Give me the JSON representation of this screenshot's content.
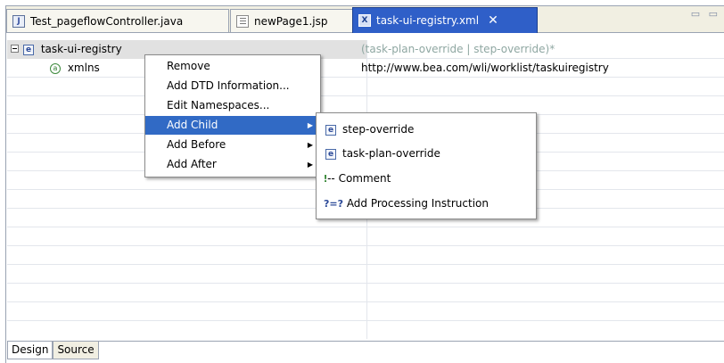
{
  "tabs": [
    {
      "label": "Test_pageflowController.java",
      "icon": "java-file-icon",
      "icon_glyph": "J"
    },
    {
      "label": "newPage1.jsp",
      "icon": "jsp-file-icon"
    },
    {
      "label": "task-ui-registry.xml",
      "icon": "xml-file-icon",
      "icon_glyph": "X",
      "close": "✕"
    }
  ],
  "window_controls": "▭ ▭",
  "tree": {
    "root": {
      "name": "task-ui-registry",
      "icon_glyph": "e",
      "value": "(task-plan-override | step-override)*"
    },
    "attr": {
      "name": "xmlns",
      "icon_glyph": "a",
      "value": "http://www.bea.com/wli/worklist/taskuiregistry"
    }
  },
  "context_menu": {
    "items": [
      "Remove",
      "Add DTD Information...",
      "Edit Namespaces...",
      "Add Child",
      "Add Before",
      "Add After"
    ],
    "highlighted": "Add Child"
  },
  "submenu": {
    "items": [
      {
        "label": "step-override",
        "icon": "element-icon",
        "glyph": "e"
      },
      {
        "label": "task-plan-override",
        "icon": "element-icon",
        "glyph": "e"
      },
      {
        "label": "Comment",
        "icon": "comment-icon",
        "glyph": "-- "
      },
      {
        "label": "Add Processing Instruction",
        "icon": "processing-instruction-icon",
        "glyph": "?=? "
      }
    ]
  },
  "bottom_tabs": [
    "Design",
    "Source"
  ],
  "colors": {
    "active_tab": "#2f5fc8",
    "menu_highlight": "#316ac5",
    "hint_text": "#8fa7a2"
  }
}
